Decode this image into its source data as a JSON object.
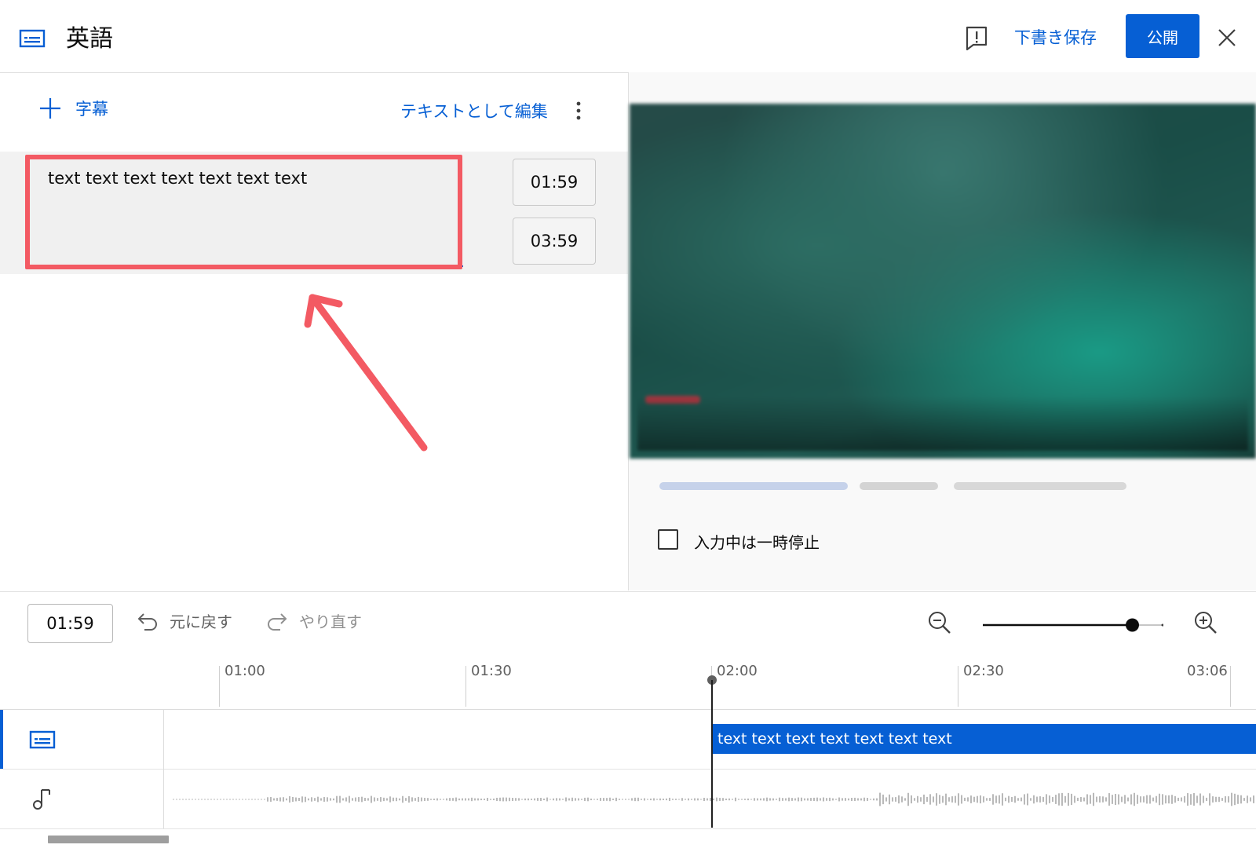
{
  "header": {
    "language_title": "英語",
    "save_draft_label": "下書き保存",
    "publish_label": "公開"
  },
  "editor": {
    "add_subtitle_label": "字幕",
    "edit_as_text_label": "テキストとして編集",
    "caption": {
      "text": "text text text text text text text",
      "start_time": "01:59",
      "end_time": "03:59"
    }
  },
  "preview": {
    "pause_while_typing_label": "入力中は一時停止",
    "pause_while_typing_checked": false
  },
  "timeline": {
    "current_time": "01:59",
    "undo_label": "元に戻す",
    "redo_label": "やり直す",
    "zoom_level": 0.84,
    "ruler": [
      {
        "label": "01:00"
      },
      {
        "label": "01:30"
      },
      {
        "label": "02:00"
      },
      {
        "label": "02:30"
      },
      {
        "label": "03:06"
      }
    ],
    "cue_text": "text text text text text text text"
  },
  "colors": {
    "accent": "#065fd4",
    "highlight_annotation": "#f35a63"
  }
}
